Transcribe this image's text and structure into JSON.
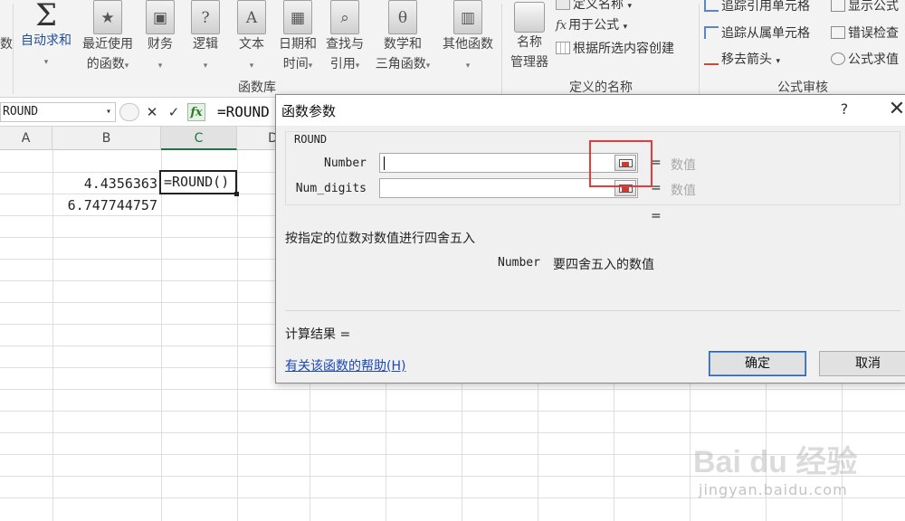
{
  "ribbon": {
    "left_partial_label": "数",
    "autosum": {
      "label": "自动求和"
    },
    "recent": {
      "line1": "最近使用",
      "line2": "的函数"
    },
    "financial": {
      "label": "财务"
    },
    "logical": {
      "label": "逻辑"
    },
    "text": {
      "label": "文本"
    },
    "datetime": {
      "line1": "日期和",
      "line2": "时间"
    },
    "lookup": {
      "line1": "查找与",
      "line2": "引用"
    },
    "math": {
      "line1": "数学和",
      "line2": "三角函数"
    },
    "other": {
      "label": "其他函数"
    },
    "group_function_library": "函数库",
    "name_manager": {
      "line1": "名称",
      "line2": "管理器"
    },
    "define_name": "定义名称",
    "use_in_formula": "用于公式",
    "create_from_selection": "根据所选内容创建",
    "group_defined_names": "定义的名称",
    "trace_precedents": "追踪引用单元格",
    "trace_dependents": "追踪从属单元格",
    "remove_arrows": "移去箭头",
    "show_formulas": "显示公式",
    "error_checking": "错误检查",
    "evaluate_formula": "公式求值",
    "group_formula_auditing": "公式审核",
    "icon_glyphs": {
      "sigma": "Σ",
      "logical": "?",
      "text": "A",
      "math": "θ"
    }
  },
  "formula_bar": {
    "name_box": "ROUND",
    "dropdown_glyph": "▾",
    "cancel_glyph": "✕",
    "enter_glyph": "✓",
    "fx_glyph": "fx",
    "formula": "=ROUND"
  },
  "sheet": {
    "columns": [
      "A",
      "B",
      "C",
      "D"
    ],
    "cells": {
      "b2": "4.4356363",
      "b3": "6.747744757",
      "c2": "=ROUND()"
    }
  },
  "dialog": {
    "title": "函数参数",
    "help_glyph": "?",
    "close_glyph": "✕",
    "function_name": "ROUND",
    "args": [
      {
        "label": "Number",
        "value": "",
        "equals": "=",
        "result": "数值"
      },
      {
        "label": "Num_digits",
        "value": "",
        "equals": "=",
        "result": "数值"
      }
    ],
    "overall_equals": "=",
    "description": "按指定的位数对数值进行四舍五入",
    "arg_help_name": "Number",
    "arg_help_text": "要四舍五入的数值",
    "result_label": "计算结果 =",
    "help_link": "有关该函数的帮助(H)",
    "ok": "确定",
    "cancel": "取消",
    "highlight_color": "#e83a3a"
  },
  "watermark": {
    "logo": "Bai du 经验",
    "url": "jingyan.baidu.com"
  }
}
